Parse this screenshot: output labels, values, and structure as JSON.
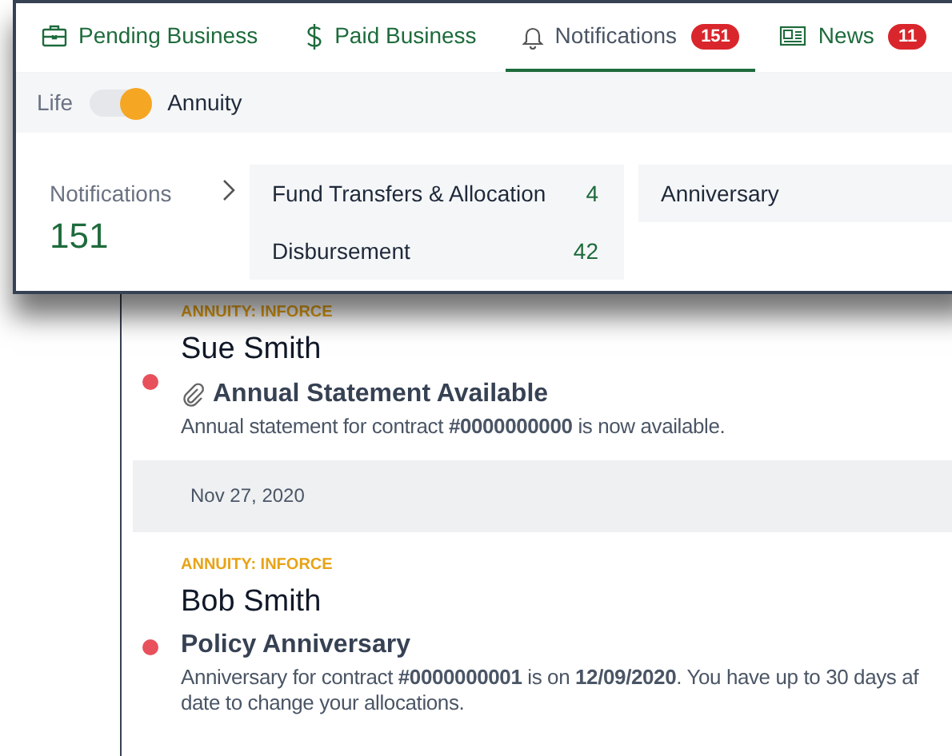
{
  "tabs": [
    {
      "kind": "briefcase",
      "label": "Pending Business",
      "selected": false
    },
    {
      "kind": "dollar",
      "label": "Paid Business",
      "selected": false
    },
    {
      "kind": "bell",
      "label": "Notifications",
      "badge": "151",
      "selected": true
    },
    {
      "kind": "newspaper",
      "label": "News",
      "badge": "11",
      "selected": false
    }
  ],
  "product_toggle": {
    "left_label": "Life",
    "right_label": "Annuity",
    "on": true
  },
  "summary": {
    "label": "Notifications",
    "count": "151"
  },
  "categories": [
    [
      {
        "label": "Fund Transfers & Allocation",
        "count": "4"
      },
      {
        "label": "Disbursement",
        "count": "42"
      }
    ],
    [
      {
        "label": "Anniversary"
      }
    ]
  ],
  "feed": [
    {
      "kind": "notification",
      "tag": "ANNUITY: INFORCE",
      "name": "Sue Smith",
      "title": "Annual Statement Available",
      "attachment": true,
      "unread": true,
      "lines": [
        "Annual statement for contract **#0000000000** is now available."
      ]
    },
    {
      "kind": "date",
      "label": "Nov 27, 2020"
    },
    {
      "kind": "notification",
      "tag": "ANNUITY: INFORCE",
      "name": "Bob Smith",
      "title": "Policy Anniversary",
      "attachment": false,
      "unread": true,
      "lines": [
        "Anniversary for contract **#0000000001** is on **12/09/2020**. You have up to 30 days af",
        "date to change your allocations."
      ]
    }
  ]
}
